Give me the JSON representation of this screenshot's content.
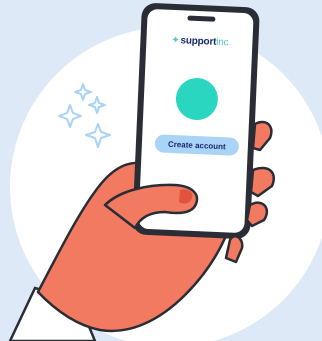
{
  "app": {
    "logo_text_1": "support",
    "logo_text_2": "inc",
    "primary_button_label": "Create account"
  },
  "colors": {
    "background": "#dde9f7",
    "circle": "#ffffff",
    "hand": "#f27a61",
    "sleeve": "#ffffff",
    "phone_body": "#2a2d35",
    "screen": "#ffffff",
    "avatar": "#2ad6c0",
    "button": "#a9d3f7",
    "sparkle": "#a9d3f7",
    "outline": "#2a2d35"
  },
  "icons": [
    "sparkle-icon",
    "notch-icon",
    "avatar-circle-icon"
  ]
}
